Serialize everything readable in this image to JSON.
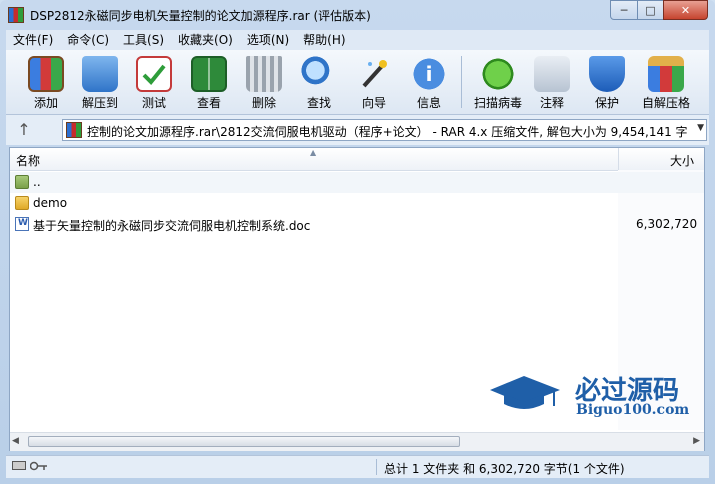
{
  "window": {
    "title": "DSP2812永磁同步电机矢量控制的论文加源程序.rar (评估版本)",
    "controls": {
      "minimize": "─",
      "maximize": "□",
      "close": "✕"
    }
  },
  "menu": [
    "文件(F)",
    "命令(C)",
    "工具(S)",
    "收藏夹(O)",
    "选项(N)",
    "帮助(H)"
  ],
  "toolbar": [
    {
      "label": "添加",
      "icon": "add-archive-icon"
    },
    {
      "label": "解压到",
      "icon": "extract-to-icon"
    },
    {
      "label": "测试",
      "icon": "test-icon"
    },
    {
      "label": "查看",
      "icon": "view-icon"
    },
    {
      "label": "删除",
      "icon": "delete-icon"
    },
    {
      "label": "查找",
      "icon": "find-icon"
    },
    {
      "label": "向导",
      "icon": "wizard-icon"
    },
    {
      "label": "信息",
      "icon": "info-icon"
    },
    {
      "label": "扫描病毒",
      "icon": "virus-scan-icon"
    },
    {
      "label": "注释",
      "icon": "comment-icon"
    },
    {
      "label": "保护",
      "icon": "protect-icon"
    },
    {
      "label": "自解压格",
      "icon": "sfx-icon"
    }
  ],
  "address": {
    "up_glyph": "↑",
    "path": "控制的论文加源程序.rar\\2812交流伺服电机驱动（程序+论文） - RAR 4.x 压缩文件, 解包大小为 9,454,141 字节",
    "dropdown": "▼"
  },
  "columns": {
    "name": "名称",
    "size": "大小",
    "sort_glyph": "▲"
  },
  "files": [
    {
      "name": "..",
      "size": "",
      "type": "parent-folder"
    },
    {
      "name": "demo",
      "size": "",
      "type": "folder"
    },
    {
      "name": "基于矢量控制的永磁同步交流伺服电机控制系统.doc",
      "size": "6,302,720",
      "type": "doc"
    }
  ],
  "watermark": {
    "title": "必过源码",
    "url": "Biguo100.com"
  },
  "scrollbar": {
    "left": "◀",
    "right": "▶"
  },
  "status": {
    "text": "总计 1 文件夹 和 6,302,720 字节(1 个文件)"
  },
  "colors": {
    "accent": "#1f5fa8",
    "close": "#c6442f",
    "titlebar": "#c7d9ee"
  }
}
